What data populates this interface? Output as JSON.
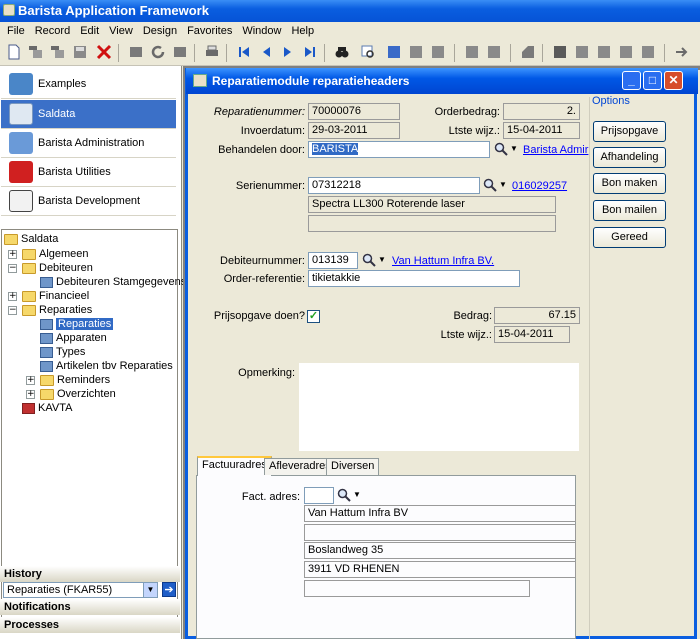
{
  "app": {
    "title": "Barista Application Framework"
  },
  "menu": [
    "File",
    "Record",
    "Edit",
    "View",
    "Design",
    "Favorites",
    "Window",
    "Help"
  ],
  "nav": [
    "Examples",
    "Saldata",
    "Barista Administration",
    "Barista Utilities",
    "Barista Development"
  ],
  "tree": {
    "root": "Saldata",
    "algemeen": "Algemeen",
    "debiteuren": "Debiteuren",
    "debstam": "Debiteuren Stamgegevens",
    "financieel": "Financieel",
    "reparaties": "Reparaties",
    "rep_reparaties": "Reparaties",
    "rep_apparaten": "Apparaten",
    "rep_types": "Types",
    "rep_artikelen": "Artikelen tbv Reparaties",
    "rep_reminders": "Reminders",
    "rep_overzichten": "Overzichten",
    "kavta": "KAVTA"
  },
  "sections": {
    "history": "History",
    "history_value": "Reparaties (FKAR55)",
    "notifications": "Notifications",
    "processes": "Processes"
  },
  "window": {
    "title": "Reparatiemodule  reparatieheaders"
  },
  "form": {
    "reparatienummer_label": "Reparatienummer:",
    "reparatienummer": "70000076",
    "orderbedrag_label": "Orderbedrag:",
    "orderbedrag": "2.",
    "invoerdatum_label": "Invoerdatum:",
    "invoerdatum": "29-03-2011",
    "ltste_wijz_label": "Ltste wijz.:",
    "ltste_wijz": "15-04-2011",
    "behandelen_label": "Behandelen door:",
    "behandelen": "BARISTA",
    "behandelen_link": "Barista Admir",
    "serienummer_label": "Serienummer:",
    "serienummer": "07312218",
    "serienummer_link": "016029257",
    "serie_desc": "Spectra LL300 Roterende laser",
    "serie_desc2": "",
    "debiteur_label": "Debiteurnummer:",
    "debiteur": "013139",
    "debiteur_link": "Van Hattum Infra BV.",
    "orderref_label": "Order-referentie:",
    "orderref": "tikietakkie",
    "prijsopgave_label": "Prijsopgave doen?",
    "bedrag_label": "Bedrag:",
    "bedrag": "67.15",
    "ltste_wijz2_label": "Ltste wijz.:",
    "ltste_wijz2": "15-04-2011",
    "opmerking_label": "Opmerking:",
    "opmerking": ""
  },
  "options": {
    "title": "Options",
    "buttons": [
      "Prijsopgave",
      "Afhandeling",
      "Bon maken",
      "Bon mailen",
      "Gereed"
    ]
  },
  "tabs": [
    "Factuuradres",
    "Afleveradres",
    "Diversen"
  ],
  "fact": {
    "label": "Fact. adres:",
    "value": "",
    "line1": "Van Hattum Infra BV",
    "line2": "",
    "line3": "Boslandweg 35",
    "line4": "3911 VD RHENEN",
    "line5": ""
  }
}
